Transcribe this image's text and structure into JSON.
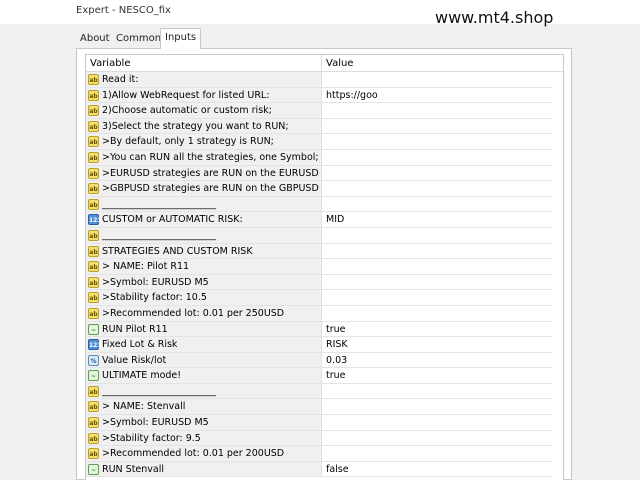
{
  "window": {
    "title": "Expert - NESCO_fix",
    "watermark": "www.mt4.shop"
  },
  "tabs": [
    {
      "label": "About"
    },
    {
      "label": "Common"
    },
    {
      "label": "Inputs"
    }
  ],
  "table": {
    "headers": {
      "variable": "Variable",
      "value": "Value"
    },
    "rows": [
      {
        "icon": "ab",
        "label": "Read it:",
        "value": ""
      },
      {
        "icon": "ab",
        "label": "1)Allow WebRequest for listed URL:",
        "value": "https://goo"
      },
      {
        "icon": "ab",
        "label": "2)Choose automatic or custom risk;",
        "value": ""
      },
      {
        "icon": "ab",
        "label": "3)Select the strategy you want to RUN;",
        "value": ""
      },
      {
        "icon": "ab",
        "label": ">By default, only 1 strategy is RUN;",
        "value": ""
      },
      {
        "icon": "ab",
        "label": ">You can RUN all the strategies, one Symbol;",
        "value": ""
      },
      {
        "icon": "ab",
        "label": ">EURUSD strategies are RUN on the EURUSD ...",
        "value": ""
      },
      {
        "icon": "ab",
        "label": ">GBPUSD strategies are RUN on the GBPUSD ...",
        "value": ""
      },
      {
        "icon": "ab",
        "label": "________________________",
        "value": ""
      },
      {
        "icon": "123",
        "label": "CUSTOM or AUTOMATIC RISK:",
        "value": "MID"
      },
      {
        "icon": "ab",
        "label": "________________________",
        "value": ""
      },
      {
        "icon": "ab",
        "label": "STRATEGIES AND CUSTOM RISK",
        "value": ""
      },
      {
        "icon": "ab",
        "label": "> NAME: Pilot R11",
        "value": ""
      },
      {
        "icon": "ab",
        "label": ">Symbol: EURUSD M5",
        "value": ""
      },
      {
        "icon": "ab",
        "label": ">Stability factor: 10.5",
        "value": ""
      },
      {
        "icon": "ab",
        "label": ">Recommended lot: 0.01 per 250USD",
        "value": ""
      },
      {
        "icon": "trend",
        "label": "RUN Pilot R11",
        "value": "true"
      },
      {
        "icon": "123",
        "label": "Fixed Lot & Risk",
        "value": "RISK"
      },
      {
        "icon": "half",
        "label": "Value Risk/lot",
        "value": "0.03"
      },
      {
        "icon": "trend",
        "label": "ULTIMATE mode!",
        "value": "true"
      },
      {
        "icon": "ab",
        "label": "________________________",
        "value": ""
      },
      {
        "icon": "ab",
        "label": "> NAME: Stenvall",
        "value": ""
      },
      {
        "icon": "ab",
        "label": ">Symbol: EURUSD M5",
        "value": ""
      },
      {
        "icon": "ab",
        "label": ">Stability factor: 9.5",
        "value": ""
      },
      {
        "icon": "ab",
        "label": ">Recommended lot: 0.01 per 200USD",
        "value": ""
      },
      {
        "icon": "trend",
        "label": "RUN Stenvall",
        "value": "false"
      }
    ]
  },
  "icons": {
    "ab": "ab",
    "123": "123",
    "trend": "~",
    "half": "%"
  },
  "colors": {
    "variable_bg": "#f0f0f0",
    "string_icon": "#f3df6a",
    "enum_icon": "#4d8fd8",
    "bool_icon": "#5aa04a"
  }
}
